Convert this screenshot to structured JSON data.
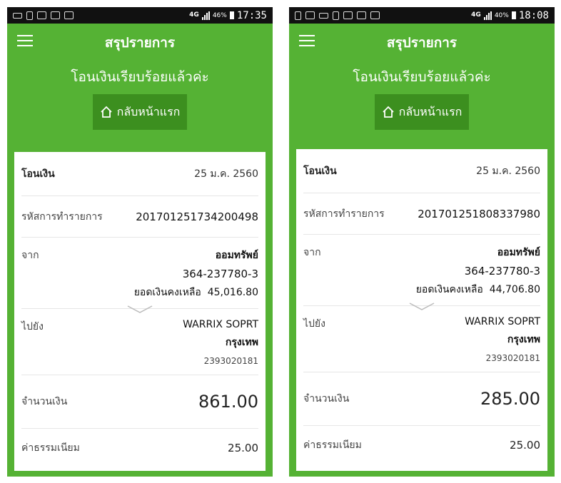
{
  "theme": {
    "green": "#55b234",
    "button_green": "#3c8f1f",
    "statusbar": "#111111"
  },
  "screens": [
    {
      "status": {
        "network": "4G",
        "battery": "46%",
        "time": "17:35",
        "icons": [
          "keyboard-icon",
          "sim-icon",
          "mail-icon",
          "clipboard-icon",
          "bag-icon"
        ]
      },
      "appbar": {
        "title": "สรุปรายการ"
      },
      "success_message": "โอนเงินเรียบร้อยแล้วค่ะ",
      "home_button": {
        "label": "กลับหน้าแรก"
      },
      "details": {
        "title_label": "โอนเงิน",
        "date": "25 ม.ค. 2560",
        "ref_label": "รหัสการทำรายการ",
        "ref_value": "201701251734200498",
        "from_label": "จาก",
        "from_account_type": "ออมทรัพย์",
        "from_account_no": "364-237780-3",
        "from_balance_label": "ยอดเงินคงเหลือ",
        "from_balance": "45,016.80",
        "to_label": "ไปยัง",
        "to_name": "WARRIX SOPRT",
        "to_bank": "กรุงเทพ",
        "to_account_no": "2393020181",
        "amount_label": "จำนวนเงิน",
        "amount": "861.00",
        "fee_label": "ค่าธรรมเนียม",
        "fee": "25.00"
      }
    },
    {
      "status": {
        "network": "4G",
        "battery": "40%",
        "time": "18:08",
        "icons": [
          "usb-icon",
          "image-icon",
          "keyboard-icon",
          "sim-icon",
          "mail-icon",
          "clipboard-icon",
          "bag-icon"
        ]
      },
      "appbar": {
        "title": "สรุปรายการ"
      },
      "success_message": "โอนเงินเรียบร้อยแล้วค่ะ",
      "home_button": {
        "label": "กลับหน้าแรก"
      },
      "details": {
        "title_label": "โอนเงิน",
        "date": "25 ม.ค. 2560",
        "ref_label": "รหัสการทำรายการ",
        "ref_value": "201701251808337980",
        "from_label": "จาก",
        "from_account_type": "ออมทรัพย์",
        "from_account_no": "364-237780-3",
        "from_balance_label": "ยอดเงินคงเหลือ",
        "from_balance": "44,706.80",
        "to_label": "ไปยัง",
        "to_name": "WARRIX SOPRT",
        "to_bank": "กรุงเทพ",
        "to_account_no": "2393020181",
        "amount_label": "จำนวนเงิน",
        "amount": "285.00",
        "fee_label": "ค่าธรรมเนียม",
        "fee": "25.00"
      }
    }
  ]
}
